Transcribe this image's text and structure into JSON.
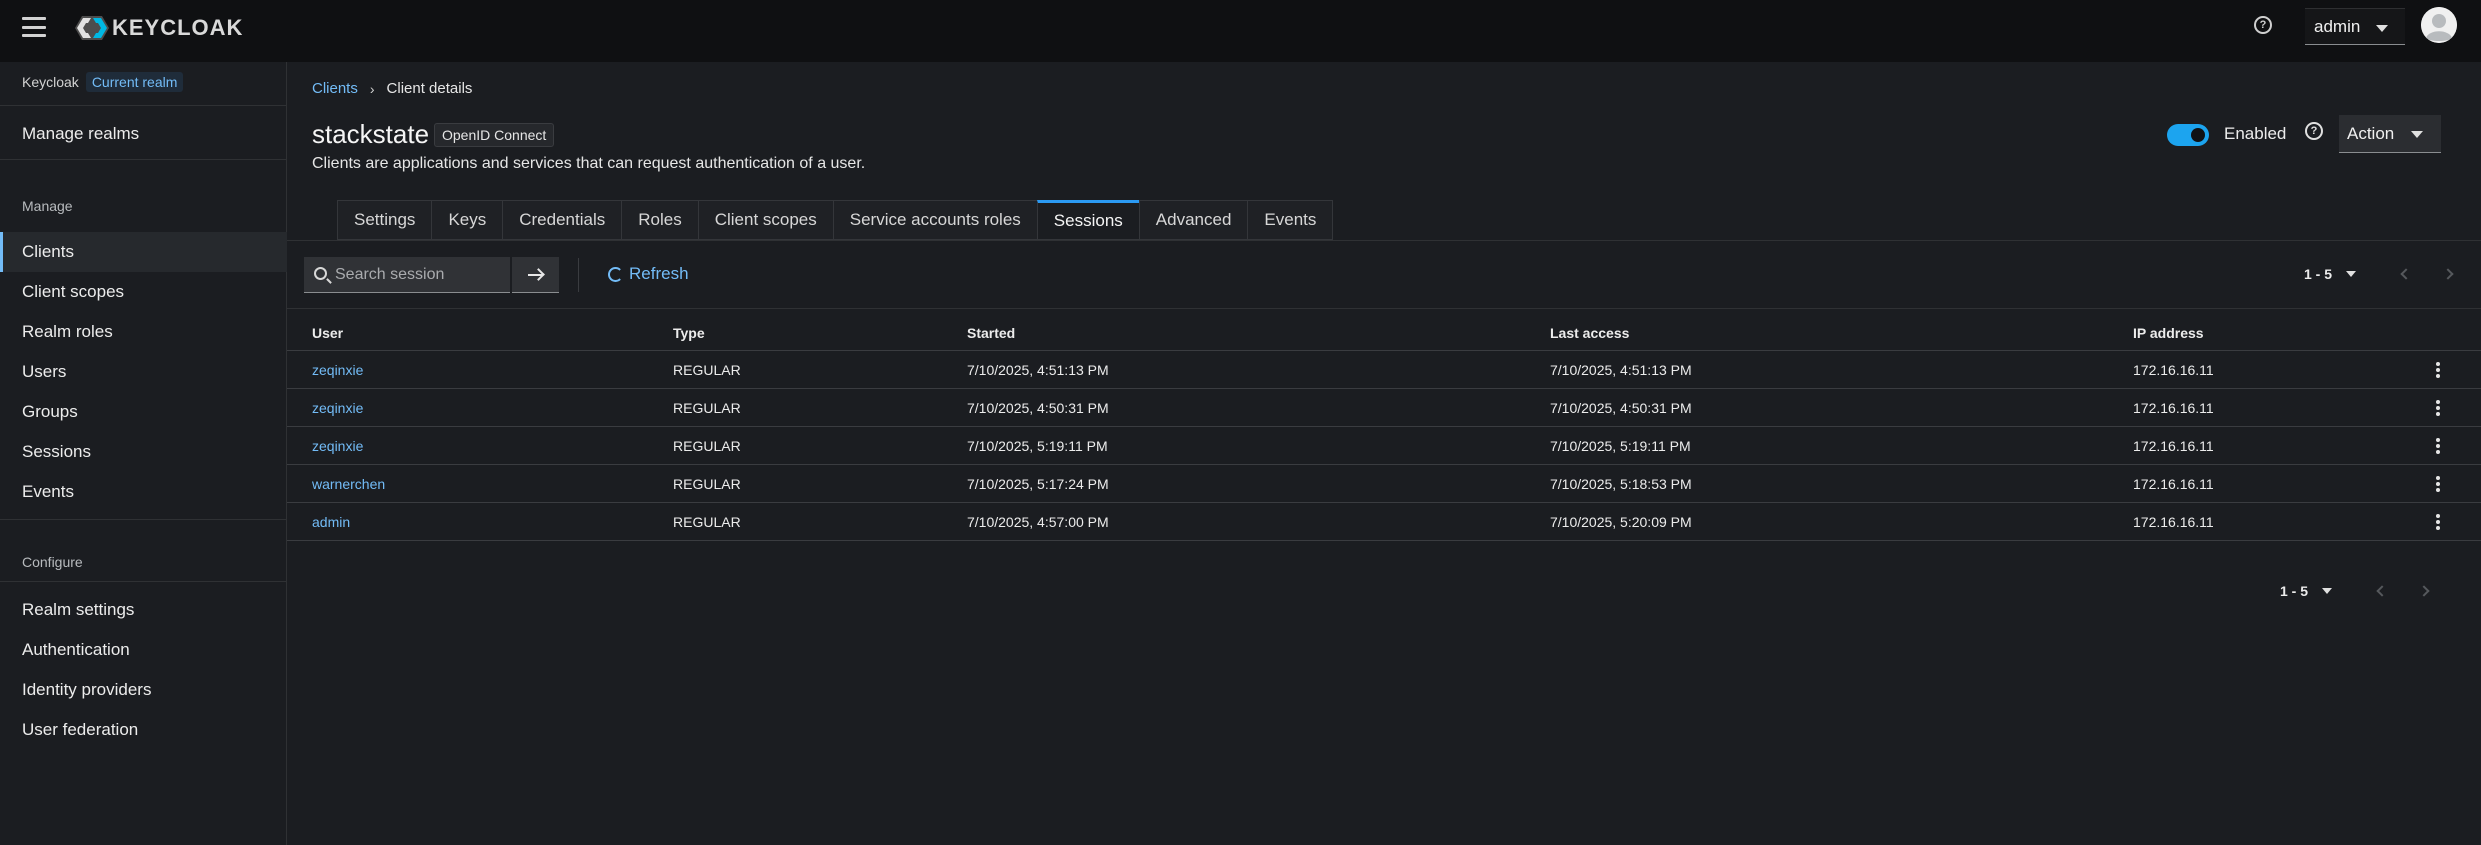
{
  "masthead": {
    "brand": "KEYCLOAK",
    "user": "admin"
  },
  "sidebar": {
    "realm_name": "Keycloak",
    "realm_badge": "Current realm",
    "manage_realms": "Manage realms",
    "manage_heading": "Manage",
    "manage_items": [
      "Clients",
      "Client scopes",
      "Realm roles",
      "Users",
      "Groups",
      "Sessions",
      "Events"
    ],
    "configure_heading": "Configure",
    "configure_items": [
      "Realm settings",
      "Authentication",
      "Identity providers",
      "User federation"
    ]
  },
  "breadcrumb": {
    "parent": "Clients",
    "current": "Client details"
  },
  "header": {
    "title": "stackstate",
    "protocol": "OpenID Connect",
    "description": "Clients are applications and services that can request authentication of a user.",
    "enabled_label": "Enabled",
    "enabled": true,
    "action_label": "Action"
  },
  "tabs": [
    "Settings",
    "Keys",
    "Credentials",
    "Roles",
    "Client scopes",
    "Service accounts roles",
    "Sessions",
    "Advanced",
    "Events"
  ],
  "active_tab": "Sessions",
  "toolbar": {
    "search_placeholder": "Search session",
    "refresh_label": "Refresh"
  },
  "pagination": {
    "range": "1 - 5"
  },
  "table": {
    "columns": [
      "User",
      "Type",
      "Started",
      "Last access",
      "IP address"
    ],
    "rows": [
      {
        "user": "zeqinxie",
        "type": "REGULAR",
        "started": "7/10/2025, 4:51:13 PM",
        "last_access": "7/10/2025, 4:51:13 PM",
        "ip": "172.16.16.11"
      },
      {
        "user": "zeqinxie",
        "type": "REGULAR",
        "started": "7/10/2025, 4:50:31 PM",
        "last_access": "7/10/2025, 4:50:31 PM",
        "ip": "172.16.16.11"
      },
      {
        "user": "zeqinxie",
        "type": "REGULAR",
        "started": "7/10/2025, 5:19:11 PM",
        "last_access": "7/10/2025, 5:19:11 PM",
        "ip": "172.16.16.11"
      },
      {
        "user": "warnerchen",
        "type": "REGULAR",
        "started": "7/10/2025, 5:17:24 PM",
        "last_access": "7/10/2025, 5:18:53 PM",
        "ip": "172.16.16.11"
      },
      {
        "user": "admin",
        "type": "REGULAR",
        "started": "7/10/2025, 4:57:00 PM",
        "last_access": "7/10/2025, 5:20:09 PM",
        "ip": "172.16.16.11"
      }
    ]
  },
  "colors": {
    "accent": "#73bcf7",
    "toggle_on": "#1ca4ef",
    "background": "#1b1d21",
    "masthead": "#0f1012"
  },
  "icons": [
    "hamburger-icon",
    "keycloak-logo-icon",
    "help-icon",
    "chevron-down-icon",
    "user-avatar-icon",
    "search-icon",
    "arrow-right-icon",
    "refresh-icon",
    "chevron-left-icon",
    "chevron-right-icon",
    "kebab-icon"
  ]
}
